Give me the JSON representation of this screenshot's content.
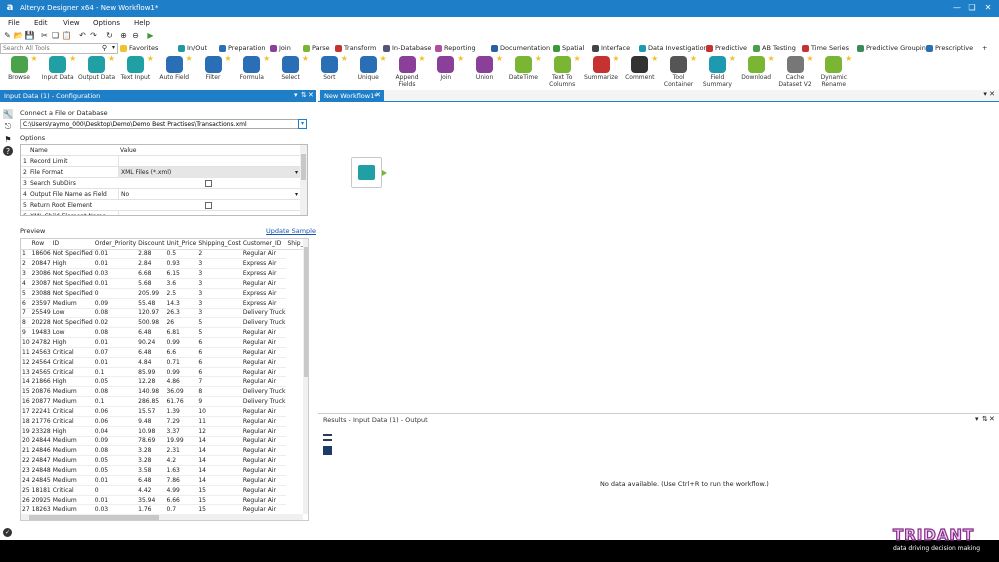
{
  "window": {
    "title": "Alteryx Designer x64 - New Workflow1*",
    "app_letter": "a"
  },
  "menu": [
    "File",
    "Edit",
    "View",
    "Options",
    "Help"
  ],
  "search": {
    "placeholder": "Search All Tools"
  },
  "categories": [
    {
      "label": "Favorites",
      "icon": "star-icon",
      "color": "#f2c12e"
    },
    {
      "label": "In/Out",
      "icon": "in-out-icon",
      "color": "#1e9aa0"
    },
    {
      "label": "Preparation",
      "icon": "preparation-icon",
      "color": "#2a6fb6"
    },
    {
      "label": "Join",
      "icon": "join-icon",
      "color": "#8a3f98"
    },
    {
      "label": "Parse",
      "icon": "parse-icon",
      "color": "#7bb534"
    },
    {
      "label": "Transform",
      "icon": "transform-icon",
      "color": "#c63232"
    },
    {
      "label": "In-Database",
      "icon": "in-database-icon",
      "color": "#555577"
    },
    {
      "label": "Reporting",
      "icon": "reporting-icon",
      "color": "#b04fa0"
    },
    {
      "label": "Documentation",
      "icon": "documentation-icon",
      "color": "#2a5fa0"
    },
    {
      "label": "Spatial",
      "icon": "spatial-icon",
      "color": "#3a9a3a"
    },
    {
      "label": "Interface",
      "icon": "interface-icon",
      "color": "#444444"
    },
    {
      "label": "Data Investigation",
      "icon": "data-investigation-icon",
      "color": "#1e9ab0"
    },
    {
      "label": "Predictive",
      "icon": "predictive-icon",
      "color": "#c63232"
    },
    {
      "label": "AB Testing",
      "icon": "ab-testing-icon",
      "color": "#4aa04a"
    },
    {
      "label": "Time Series",
      "icon": "time-series-icon",
      "color": "#c63232"
    },
    {
      "label": "Predictive Grouping",
      "icon": "predictive-grouping-icon",
      "color": "#3a8a5a"
    },
    {
      "label": "Prescriptive",
      "icon": "prescriptive-icon",
      "color": "#2a6fb6"
    }
  ],
  "tools": [
    {
      "label": "Browse",
      "color": "#4aa34a"
    },
    {
      "label": "Input Data",
      "color": "#20a0a4"
    },
    {
      "label": "Output Data",
      "color": "#20a0a4"
    },
    {
      "label": "Text Input",
      "color": "#20a0a4"
    },
    {
      "label": "Auto Field",
      "color": "#2a6fb6"
    },
    {
      "label": "Filter",
      "color": "#2a6fb6"
    },
    {
      "label": "Formula",
      "color": "#2a6fb6"
    },
    {
      "label": "Select",
      "color": "#2a6fb6"
    },
    {
      "label": "Sort",
      "color": "#2a6fb6"
    },
    {
      "label": "Unique",
      "color": "#2a6fb6"
    },
    {
      "label": "Append Fields",
      "color": "#8a3f98"
    },
    {
      "label": "Join",
      "color": "#8a3f98"
    },
    {
      "label": "Union",
      "color": "#8a3f98"
    },
    {
      "label": "DateTime",
      "color": "#7bb534"
    },
    {
      "label": "Text To Columns",
      "color": "#7bb534"
    },
    {
      "label": "Summarize",
      "color": "#c63232"
    },
    {
      "label": "Comment",
      "color": "#333333"
    },
    {
      "label": "Tool Container",
      "color": "#555555"
    },
    {
      "label": "Field Summary",
      "color": "#1e9ab0"
    },
    {
      "label": "Download",
      "color": "#7bb534"
    },
    {
      "label": "Cache Dataset V2",
      "color": "#777777"
    },
    {
      "label": "Dynamic Rename",
      "color": "#7bb534"
    }
  ],
  "config": {
    "title": "Input Data (1) - Configuration",
    "connect_label": "Connect a File or Database",
    "file_path": "C:\\Users\\raymo_000\\Desktop\\Demo\\Demo Best Practises\\Transactions.xml",
    "options_label": "Options",
    "grid_header": {
      "name": "Name",
      "value": "Value"
    },
    "grid_rows": [
      {
        "num": "1",
        "name": "Record Limit",
        "value": "",
        "kind": "text"
      },
      {
        "num": "2",
        "name": "File Format",
        "value": "XML Files (*.xml)",
        "kind": "dropdown"
      },
      {
        "num": "3",
        "name": "Search SubDirs",
        "value": "",
        "kind": "checkbox"
      },
      {
        "num": "4",
        "name": "Output File Name as Field",
        "value": "No",
        "kind": "dropdown"
      },
      {
        "num": "5",
        "name": "Return Root Element",
        "value": "",
        "kind": "checkbox"
      },
      {
        "num": "6",
        "name": "XML Child Element Name",
        "value": "",
        "kind": "text"
      }
    ],
    "preview_label": "Preview",
    "update_sample": "Update Sample"
  },
  "preview": {
    "columns": [
      "Row",
      "ID",
      "Order_Priority",
      "Discount",
      "Unit_Price",
      "Shipping_Cost",
      "Customer_ID",
      "Ship_Mode"
    ],
    "rows": [
      [
        "1",
        "18606",
        "Not Specified",
        "0.01",
        "2.88",
        "0.5",
        "2",
        "Regular Air"
      ],
      [
        "2",
        "20847",
        "High",
        "0.01",
        "2.84",
        "0.93",
        "3",
        "Express Air"
      ],
      [
        "3",
        "23086",
        "Not Specified",
        "0.03",
        "6.68",
        "6.15",
        "3",
        "Express Air"
      ],
      [
        "4",
        "23087",
        "Not Specified",
        "0.01",
        "5.68",
        "3.6",
        "3",
        "Regular Air"
      ],
      [
        "5",
        "23088",
        "Not Specified",
        "0",
        "205.99",
        "2.5",
        "3",
        "Express Air"
      ],
      [
        "6",
        "23597",
        "Medium",
        "0.09",
        "55.48",
        "14.3",
        "3",
        "Express Air"
      ],
      [
        "7",
        "25549",
        "Low",
        "0.08",
        "120.97",
        "26.3",
        "3",
        "Delivery Truck"
      ],
      [
        "8",
        "20228",
        "Not Specified",
        "0.02",
        "500.98",
        "26",
        "5",
        "Delivery Truck"
      ],
      [
        "9",
        "19483",
        "Low",
        "0.08",
        "6.48",
        "6.81",
        "5",
        "Regular Air"
      ],
      [
        "10",
        "24782",
        "High",
        "0.01",
        "90.24",
        "0.99",
        "6",
        "Regular Air"
      ],
      [
        "11",
        "24563",
        "Critical",
        "0.07",
        "6.48",
        "6.6",
        "6",
        "Regular Air"
      ],
      [
        "12",
        "24564",
        "Critical",
        "0.01",
        "4.84",
        "0.71",
        "6",
        "Regular Air"
      ],
      [
        "13",
        "24565",
        "Critical",
        "0.1",
        "85.99",
        "0.99",
        "6",
        "Regular Air"
      ],
      [
        "14",
        "21866",
        "High",
        "0.05",
        "12.28",
        "4.86",
        "7",
        "Regular Air"
      ],
      [
        "15",
        "20876",
        "Medium",
        "0.08",
        "140.98",
        "36.09",
        "8",
        "Delivery Truck"
      ],
      [
        "16",
        "20877",
        "Medium",
        "0.1",
        "286.85",
        "61.76",
        "9",
        "Delivery Truck"
      ],
      [
        "17",
        "22241",
        "Critical",
        "0.06",
        "15.57",
        "1.39",
        "10",
        "Regular Air"
      ],
      [
        "18",
        "21776",
        "Critical",
        "0.06",
        "9.48",
        "7.29",
        "11",
        "Regular Air"
      ],
      [
        "19",
        "23328",
        "High",
        "0.04",
        "10.98",
        "3.37",
        "12",
        "Regular Air"
      ],
      [
        "20",
        "24844",
        "Medium",
        "0.09",
        "78.69",
        "19.99",
        "14",
        "Regular Air"
      ],
      [
        "21",
        "24846",
        "Medium",
        "0.08",
        "3.28",
        "2.31",
        "14",
        "Regular Air"
      ],
      [
        "22",
        "24847",
        "Medium",
        "0.05",
        "3.28",
        "4.2",
        "14",
        "Regular Air"
      ],
      [
        "23",
        "24848",
        "Medium",
        "0.05",
        "3.58",
        "1.63",
        "14",
        "Regular Air"
      ],
      [
        "24",
        "24845",
        "Medium",
        "0.01",
        "6.48",
        "7.86",
        "14",
        "Regular Air"
      ],
      [
        "25",
        "18181",
        "Critical",
        "0",
        "4.42",
        "4.99",
        "15",
        "Regular Air"
      ],
      [
        "26",
        "20925",
        "Medium",
        "0.01",
        "35.94",
        "6.66",
        "15",
        "Regular Air"
      ],
      [
        "27",
        "18263",
        "Medium",
        "0.03",
        "1.76",
        "0.7",
        "15",
        "Regular Air"
      ]
    ]
  },
  "workflow": {
    "tab_label": "New Workflow1*"
  },
  "results": {
    "title": "Results - Input Data (1) - Output",
    "empty_message": "No data available. (Use Ctrl+R to run the workflow.)"
  },
  "brand": {
    "name": "TRIDANT",
    "tagline": "data driving decision making"
  }
}
